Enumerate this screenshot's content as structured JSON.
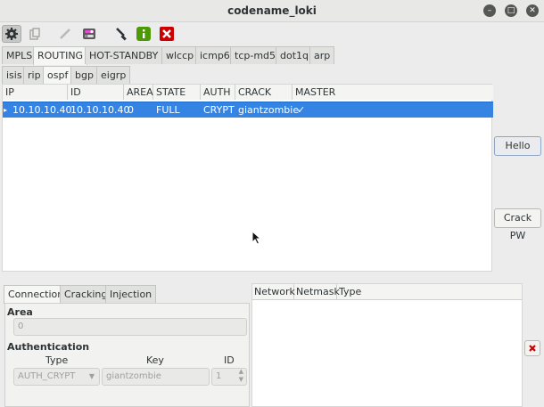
{
  "window": {
    "title": "codename_loki"
  },
  "toolbar": {
    "icons": [
      "gear-icon",
      "clipboard-icon",
      "pencil-icon",
      "toggle-icon",
      "brush-icon",
      "info-icon",
      "stop-icon"
    ]
  },
  "protocol_tabs": [
    "MPLS",
    "ROUTING",
    "HOT-STANDBY",
    "wlccp",
    "icmp6",
    "tcp-md5",
    "dot1q",
    "arp"
  ],
  "routing_tabs": [
    "isis",
    "rip",
    "ospf",
    "bgp",
    "eigrp"
  ],
  "list": {
    "columns": [
      "IP",
      "ID",
      "AREA",
      "STATE",
      "AUTH",
      "CRACK",
      "MASTER"
    ],
    "rows": [
      {
        "ip": "10.10.10.40",
        "id": "10.10.10.40",
        "area": "0",
        "state": "FULL",
        "auth": "CRYPT",
        "crack": "giantzombie",
        "master": "✓"
      }
    ]
  },
  "side_buttons": {
    "hello": "Hello",
    "crack_pw": "Crack PW"
  },
  "bottom_tabs": [
    "Connection",
    "Cracking",
    "Injection"
  ],
  "connection": {
    "area_label": "Area",
    "area_value": "0",
    "auth_label": "Authentication",
    "type_label": "Type",
    "key_label": "Key",
    "id_label": "ID",
    "type_value": "AUTH_CRYPT",
    "key_value": "giantzombie",
    "id_value": "1"
  },
  "network_list": {
    "columns": [
      "Network",
      "Netmask",
      "Type"
    ]
  },
  "colors": {
    "selection": "#3584e4",
    "accent_red": "#cc0000",
    "accent_green": "#4e9a06"
  }
}
